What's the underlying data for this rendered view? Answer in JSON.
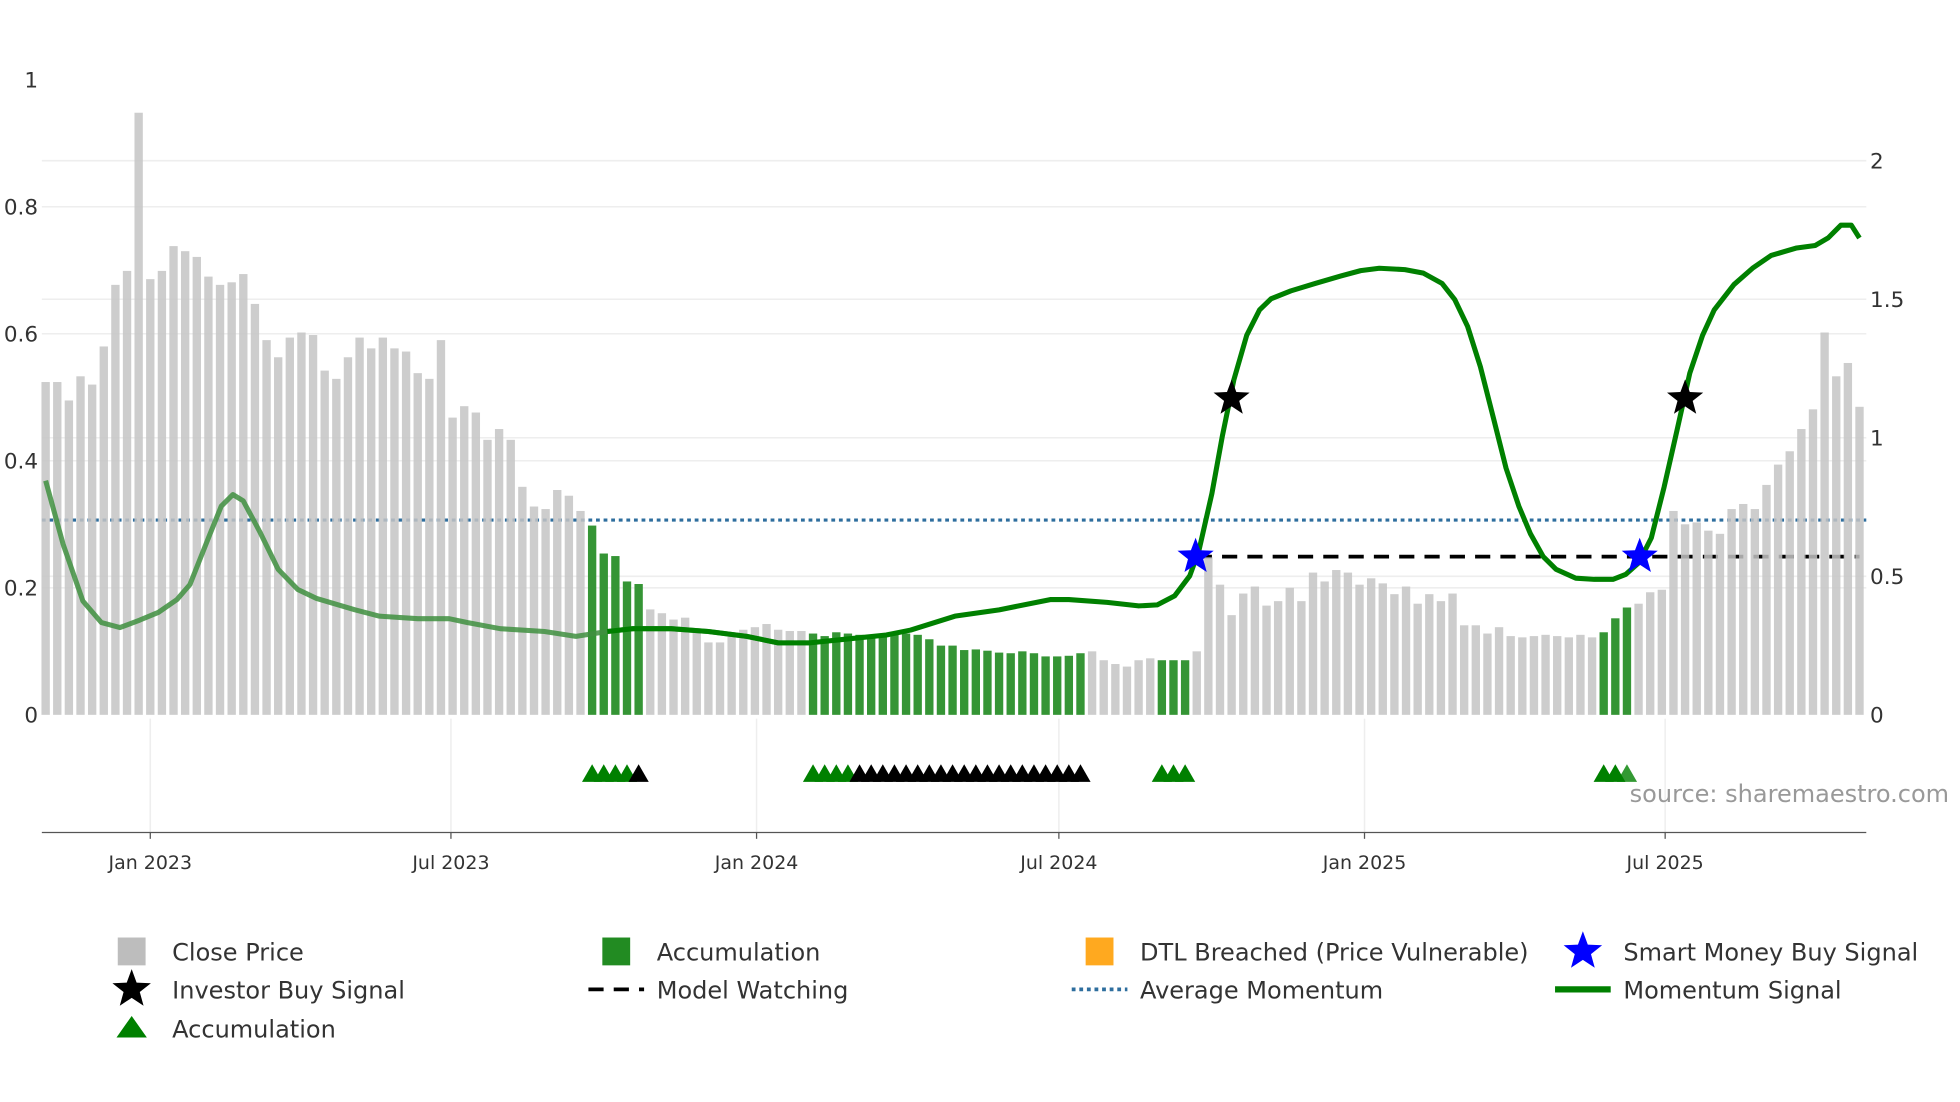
{
  "chart_data": {
    "type": "bar",
    "title": "",
    "start_date": "2022-10-30",
    "interval": "weekly",
    "left_axis": {
      "ylim": [
        0,
        1
      ],
      "ticks": [
        "0",
        "0.2",
        "0.4",
        "0.6",
        "0.8",
        "1"
      ],
      "tick_values": [
        0,
        0.2,
        0.4,
        0.6,
        0.8,
        1
      ]
    },
    "right_axis": {
      "ylim": [
        0,
        2.2
      ],
      "ticks": [
        "0",
        "0.5",
        "1",
        "1.5",
        "2"
      ],
      "tick_values": [
        0,
        0.5,
        1,
        1.5,
        2
      ]
    },
    "x_ticks": [
      {
        "label": "Jan 2023",
        "date": "2023-01-01"
      },
      {
        "label": "Jul 2023",
        "date": "2023-07-01"
      },
      {
        "label": "Jan 2024",
        "date": "2024-01-01"
      },
      {
        "label": "Jul 2024",
        "date": "2024-07-01"
      },
      {
        "label": "Jan 2025",
        "date": "2025-01-01"
      },
      {
        "label": "Jul 2025",
        "date": "2025-07-01"
      }
    ],
    "close_price": [
      0.524,
      0.524,
      0.495,
      0.533,
      0.52,
      0.58,
      0.677,
      0.699,
      0.948,
      0.686,
      0.699,
      0.738,
      0.73,
      0.721,
      0.69,
      0.677,
      0.681,
      0.694,
      0.647,
      0.59,
      0.563,
      0.594,
      0.602,
      0.598,
      0.542,
      0.529,
      0.563,
      0.594,
      0.577,
      0.594,
      0.577,
      0.572,
      0.538,
      0.529,
      0.59,
      0.468,
      0.486,
      0.476,
      0.433,
      0.45,
      0.433,
      0.359,
      0.328,
      0.324,
      0.354,
      0.345,
      0.321,
      0.298,
      0.254,
      0.25,
      0.21,
      0.206,
      0.166,
      0.16,
      0.15,
      0.153,
      0.131,
      0.114,
      0.114,
      0.128,
      0.134,
      0.138,
      0.143,
      0.134,
      0.132,
      0.132,
      0.128,
      0.124,
      0.13,
      0.128,
      0.126,
      0.126,
      0.128,
      0.13,
      0.128,
      0.126,
      0.119,
      0.109,
      0.109,
      0.102,
      0.103,
      0.101,
      0.098,
      0.097,
      0.1,
      0.097,
      0.092,
      0.092,
      0.093,
      0.097,
      0.1,
      0.086,
      0.08,
      0.076,
      0.086,
      0.089,
      0.086,
      0.086,
      0.086,
      0.1,
      0.248,
      0.205,
      0.157,
      0.191,
      0.202,
      0.172,
      0.179,
      0.2,
      0.179,
      0.224,
      0.21,
      0.228,
      0.224,
      0.205,
      0.215,
      0.207,
      0.19,
      0.202,
      0.175,
      0.19,
      0.179,
      0.191,
      0.141,
      0.141,
      0.128,
      0.138,
      0.124,
      0.122,
      0.124,
      0.126,
      0.124,
      0.122,
      0.126,
      0.122,
      0.13,
      0.152,
      0.169,
      0.175,
      0.193,
      0.197,
      0.321,
      0.3,
      0.303,
      0.29,
      0.285,
      0.324,
      0.332,
      0.324,
      0.362,
      0.394,
      0.415,
      0.45,
      0.481,
      0.602,
      0.533,
      0.554,
      0.485
    ],
    "accumulation_weeks": [
      47,
      48,
      49,
      50,
      51,
      66,
      67,
      68,
      69,
      70,
      71,
      72,
      73,
      74,
      75,
      76,
      77,
      78,
      79,
      80,
      81,
      82,
      83,
      84,
      85,
      86,
      87,
      88,
      89,
      96,
      97,
      98,
      134,
      135,
      136
    ],
    "accumulation_triangles": {
      "green": [
        47,
        48,
        49,
        50,
        66,
        67,
        68,
        69,
        96,
        97,
        98,
        134,
        135,
        136
      ],
      "black": [
        51,
        70,
        71,
        72,
        73,
        74,
        75,
        76,
        77,
        78,
        79,
        80,
        81,
        82,
        83,
        84,
        85,
        86,
        87,
        88,
        89
      ]
    },
    "momentum_signal": [
      [
        0,
        0.845
      ],
      [
        1.5,
        0.616
      ],
      [
        3.2,
        0.411
      ],
      [
        4.8,
        0.333
      ],
      [
        6.4,
        0.315
      ],
      [
        8.1,
        0.342
      ],
      [
        9.7,
        0.37
      ],
      [
        11.3,
        0.416
      ],
      [
        12.4,
        0.47
      ],
      [
        14,
        0.639
      ],
      [
        15.1,
        0.753
      ],
      [
        16.1,
        0.795
      ],
      [
        17,
        0.772
      ],
      [
        18.4,
        0.662
      ],
      [
        20,
        0.525
      ],
      [
        21.7,
        0.452
      ],
      [
        23.3,
        0.42
      ],
      [
        26.6,
        0.379
      ],
      [
        28.7,
        0.356
      ],
      [
        32,
        0.347
      ],
      [
        34.7,
        0.347
      ],
      [
        36.3,
        0.333
      ],
      [
        39.1,
        0.311
      ],
      [
        42.9,
        0.301
      ],
      [
        45.6,
        0.283
      ],
      [
        48.3,
        0.301
      ],
      [
        50.5,
        0.311
      ],
      [
        53.8,
        0.311
      ],
      [
        57,
        0.301
      ],
      [
        60.3,
        0.283
      ],
      [
        63,
        0.26
      ],
      [
        65.7,
        0.26
      ],
      [
        69,
        0.274
      ],
      [
        72.3,
        0.288
      ],
      [
        74.4,
        0.306
      ],
      [
        78.2,
        0.356
      ],
      [
        82,
        0.379
      ],
      [
        86.4,
        0.416
      ],
      [
        88,
        0.416
      ],
      [
        91.3,
        0.406
      ],
      [
        94,
        0.393
      ],
      [
        95.6,
        0.397
      ],
      [
        97.1,
        0.429
      ],
      [
        98.4,
        0.502
      ],
      [
        99.2,
        0.594
      ],
      [
        100.3,
        0.799
      ],
      [
        101.2,
        1.005
      ],
      [
        102.2,
        1.21
      ],
      [
        103.3,
        1.37
      ],
      [
        104.4,
        1.461
      ],
      [
        105.4,
        1.502
      ],
      [
        107.1,
        1.53
      ],
      [
        109.2,
        1.557
      ],
      [
        111.4,
        1.584
      ],
      [
        113.1,
        1.603
      ],
      [
        114.7,
        1.612
      ],
      [
        116.9,
        1.607
      ],
      [
        118.5,
        1.594
      ],
      [
        120.1,
        1.557
      ],
      [
        121.2,
        1.498
      ],
      [
        122.3,
        1.402
      ],
      [
        123.4,
        1.256
      ],
      [
        124.5,
        1.073
      ],
      [
        125.6,
        0.89
      ],
      [
        126.7,
        0.753
      ],
      [
        127.7,
        0.653
      ],
      [
        128.8,
        0.571
      ],
      [
        129.9,
        0.525
      ],
      [
        131.6,
        0.493
      ],
      [
        133.2,
        0.489
      ],
      [
        134.8,
        0.489
      ],
      [
        135.9,
        0.507
      ],
      [
        137,
        0.548
      ],
      [
        138.1,
        0.639
      ],
      [
        139.2,
        0.822
      ],
      [
        140.3,
        1.027
      ],
      [
        141.4,
        1.233
      ],
      [
        142.5,
        1.37
      ],
      [
        143.5,
        1.461
      ],
      [
        145.2,
        1.553
      ],
      [
        146.8,
        1.612
      ],
      [
        148.4,
        1.658
      ],
      [
        150.6,
        1.685
      ],
      [
        152.2,
        1.694
      ],
      [
        153.3,
        1.721
      ],
      [
        154.4,
        1.767
      ],
      [
        155.3,
        1.767
      ],
      [
        156,
        1.721
      ]
    ],
    "average_momentum": 0.703,
    "model_watching": {
      "value": 0.571,
      "from_week": 99,
      "to_week": 156
    },
    "smart_money_buy_signals": [
      [
        98.9,
        0.571
      ],
      [
        137.1,
        0.571
      ]
    ],
    "investor_buy_signals": [
      [
        102,
        1.142
      ],
      [
        141,
        1.142
      ]
    ],
    "legend_placement": "bottom",
    "legend": [
      {
        "label": "Close Price",
        "marker": "square",
        "color": "#bdbdbd"
      },
      {
        "label": "Accumulation",
        "marker": "square",
        "color": "#228b22"
      },
      {
        "label": "DTL Breached (Price Vulnerable)",
        "marker": "square",
        "color": "#ffa91f"
      },
      {
        "label": "Smart Money Buy Signal",
        "marker": "star",
        "color": "#0000ff"
      },
      {
        "label": "Investor Buy Signal",
        "marker": "star",
        "color": "#000000"
      },
      {
        "label": "Model Watching",
        "marker": "dashed-line",
        "color": "#000000"
      },
      {
        "label": "Average Momentum",
        "marker": "dotted-line",
        "color": "#2e6e9e"
      },
      {
        "label": "Momentum Signal",
        "marker": "line",
        "color": "#008000"
      },
      {
        "label": "Accumulation",
        "marker": "triangle",
        "color": "#008000"
      }
    ],
    "source": "source: sharemaestro.com"
  }
}
